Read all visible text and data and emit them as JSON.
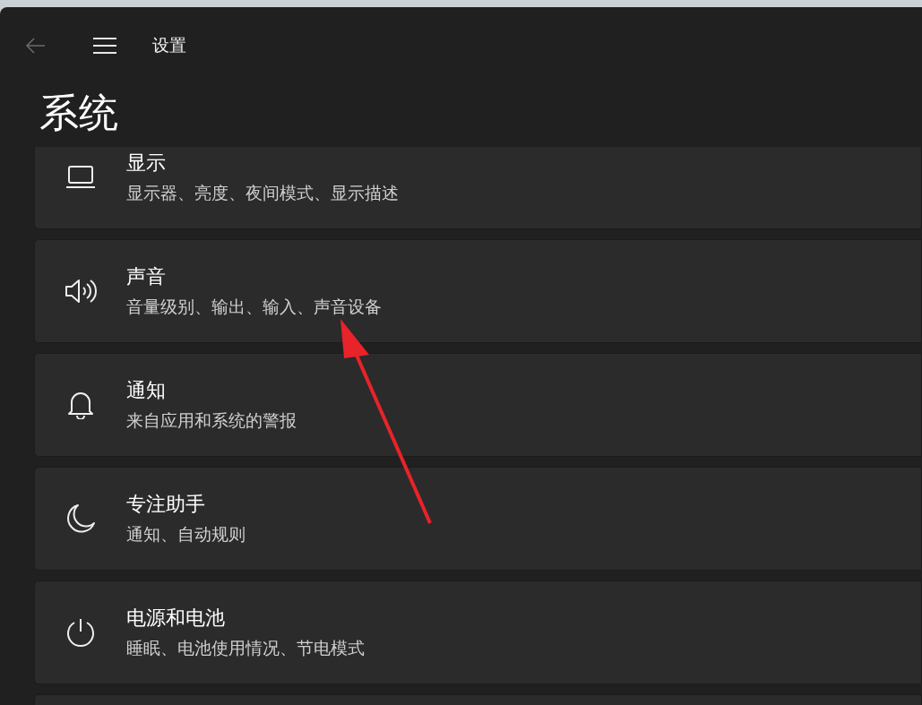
{
  "window": {
    "title": "设置",
    "back_disabled": true
  },
  "page_title": "系统",
  "items": [
    {
      "title": "显示",
      "subtitle": "显示器、亮度、夜间模式、显示描述"
    },
    {
      "title": "声音",
      "subtitle": "音量级别、输出、输入、声音设备"
    },
    {
      "title": "通知",
      "subtitle": "来自应用和系统的警报"
    },
    {
      "title": "专注助手",
      "subtitle": "通知、自动规则"
    },
    {
      "title": "电源和电池",
      "subtitle": "睡眠、电池使用情况、节电模式"
    }
  ]
}
